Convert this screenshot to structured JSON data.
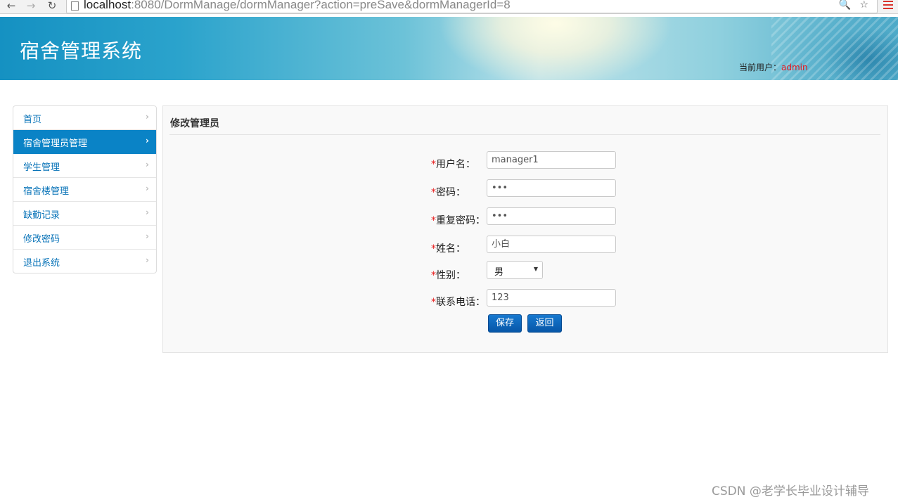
{
  "browser": {
    "url_host": "localhost",
    "url_rest": ":8080/DormManage/dormManager?action=preSave&dormManagerId=8",
    "url_icons": "🔍 ☆"
  },
  "header": {
    "system_title": "宿舍管理系统",
    "current_user_label": "当前用户：",
    "current_user_name": "admin"
  },
  "sidebar": {
    "items": [
      {
        "label": "首页"
      },
      {
        "label": "宿舍管理员管理"
      },
      {
        "label": "学生管理"
      },
      {
        "label": "宿舍楼管理"
      },
      {
        "label": "缺勤记录"
      },
      {
        "label": "修改密码"
      },
      {
        "label": "退出系统"
      }
    ],
    "active_index": 1,
    "chevron": "›"
  },
  "main": {
    "title": "修改管理员",
    "required_mark": "*",
    "fields": {
      "username": {
        "label": "用户名：",
        "value": "manager1"
      },
      "password": {
        "label": "密码：",
        "value": "•••"
      },
      "confirm_password": {
        "label": "重复密码：",
        "value": "•••"
      },
      "name": {
        "label": "姓名：",
        "value": "小白"
      },
      "gender": {
        "label": "性别：",
        "value": "男"
      },
      "phone": {
        "label": "联系电话：",
        "value": "123"
      }
    },
    "buttons": {
      "save": "保存",
      "back": "返回"
    }
  },
  "watermark": "CSDN @老学长毕业设计辅导"
}
